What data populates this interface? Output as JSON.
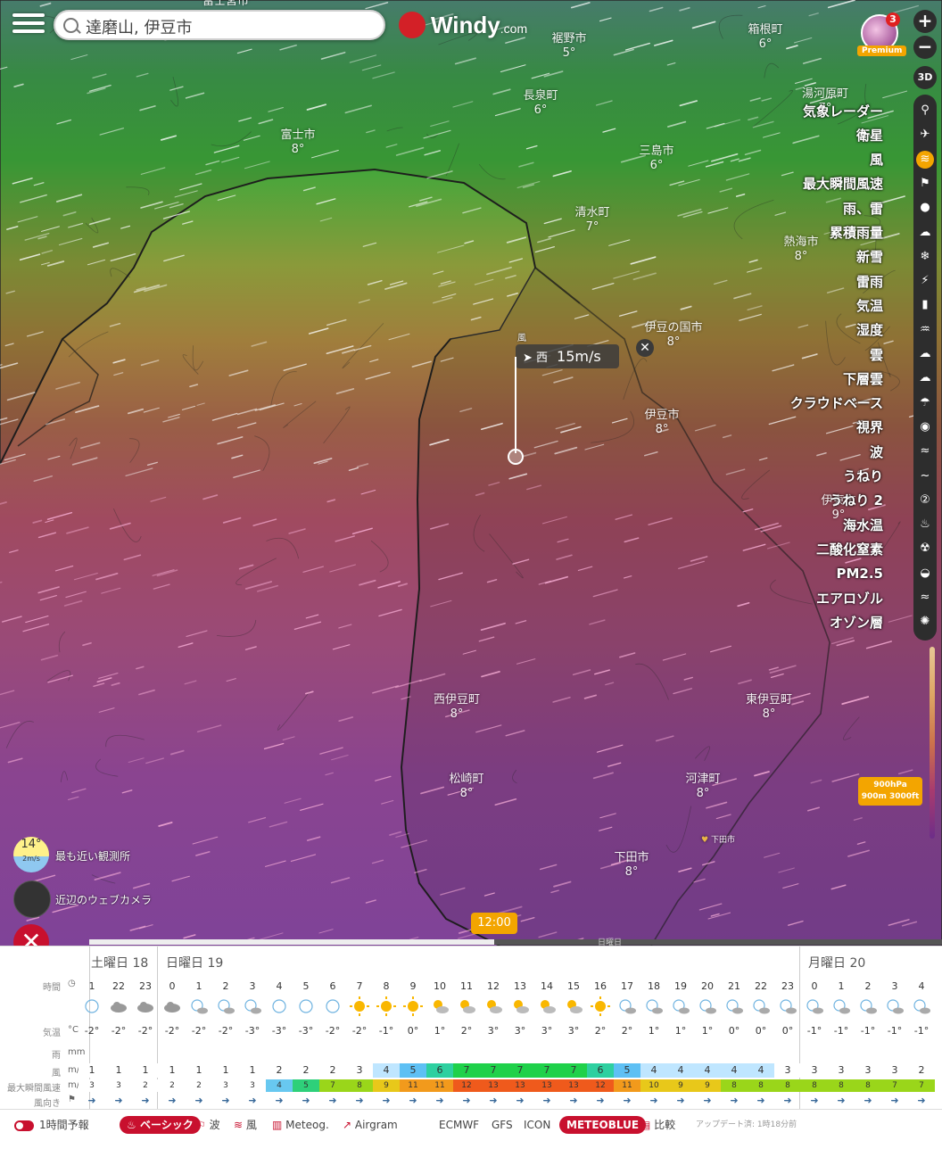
{
  "search": {
    "value": "達磨山, 伊豆市"
  },
  "logo": {
    "brand": "Windy",
    "suffix": ".com"
  },
  "user": {
    "badge": "3",
    "premium": "Premium"
  },
  "controls": {
    "zoom_in": "+",
    "zoom_out": "−",
    "view3d": "3D"
  },
  "layers": [
    {
      "label": "気象レーダー",
      "icon": "radar-icon",
      "glyph": "⚲",
      "active": false
    },
    {
      "label": "衛星",
      "icon": "satellite-icon",
      "glyph": "✈",
      "active": false
    },
    {
      "label": "風",
      "icon": "wind-icon",
      "glyph": "≋",
      "active": true
    },
    {
      "label": "最大瞬間風速",
      "icon": "flag-icon",
      "glyph": "⚑",
      "active": false
    },
    {
      "label": "雨、雷",
      "icon": "raindrop-icon",
      "glyph": "●",
      "active": false
    },
    {
      "label": "累積雨量",
      "icon": "cloud-rain-icon",
      "glyph": "☁",
      "active": false
    },
    {
      "label": "新雪",
      "icon": "snowflake-icon",
      "glyph": "❄",
      "active": false
    },
    {
      "label": "雷雨",
      "icon": "thunder-icon",
      "glyph": "⚡",
      "active": false
    },
    {
      "label": "気温",
      "icon": "thermometer-icon",
      "glyph": "▮",
      "active": false
    },
    {
      "label": "湿度",
      "icon": "humidity-icon",
      "glyph": "♒",
      "active": false
    },
    {
      "label": "雲",
      "icon": "cloud-icon",
      "glyph": "☁",
      "active": false
    },
    {
      "label": "下層雲",
      "icon": "low-cloud-icon",
      "glyph": "☁",
      "active": false
    },
    {
      "label": "クラウドベース",
      "icon": "cloud-base-icon",
      "glyph": "☂",
      "active": false
    },
    {
      "label": "視界",
      "icon": "eye-icon",
      "glyph": "◉",
      "active": false
    },
    {
      "label": "波",
      "icon": "waves-icon",
      "glyph": "≈",
      "active": false
    },
    {
      "label": "うねり",
      "icon": "swimmer-icon",
      "glyph": "~",
      "active": false
    },
    {
      "label": "うねり 2",
      "icon": "swell2-icon",
      "glyph": "②",
      "active": false
    },
    {
      "label": "海水温",
      "icon": "sea-temp-icon",
      "glyph": "♨",
      "active": false
    },
    {
      "label": "二酸化窒素",
      "icon": "no2-icon",
      "glyph": "☢",
      "active": false
    },
    {
      "label": "PM2.5",
      "icon": "pm25-icon",
      "glyph": "◒",
      "active": false
    },
    {
      "label": "エアロゾル",
      "icon": "aerosol-icon",
      "glyph": "≈",
      "active": false
    },
    {
      "label": "オゾン層",
      "icon": "ozone-icon",
      "glyph": "✺",
      "active": false
    }
  ],
  "cities": [
    {
      "name": "富士宮市",
      "temp": ""
    },
    {
      "name": "裾野市",
      "temp": "5°"
    },
    {
      "name": "箱根町",
      "temp": "6°"
    },
    {
      "name": "長泉町",
      "temp": "6°"
    },
    {
      "name": "湯河原町",
      "temp": "7°"
    },
    {
      "name": "富士市",
      "temp": "8°"
    },
    {
      "name": "三島市",
      "temp": "6°"
    },
    {
      "name": "清水町",
      "temp": "7°"
    },
    {
      "name": "熱海市",
      "temp": "8°"
    },
    {
      "name": "伊豆の国市",
      "temp": "8°"
    },
    {
      "name": "伊豆市",
      "temp": "8°"
    },
    {
      "name": "伊東市",
      "temp": "9°"
    },
    {
      "name": "西伊豆町",
      "temp": "8°"
    },
    {
      "name": "東伊豆町",
      "temp": "8°"
    },
    {
      "name": "松崎町",
      "temp": "8°"
    },
    {
      "name": "河津町",
      "temp": "8°"
    },
    {
      "name": "下田市",
      "temp": "8°"
    }
  ],
  "favorite": {
    "label": "下田市"
  },
  "popup": {
    "layer": "風",
    "direction": "西",
    "speed": "15m/s"
  },
  "pressure": {
    "level": "900hPa",
    "alt": "900m 3000ft"
  },
  "left_panel": {
    "station_temp": "14°",
    "station_wind": "2m/s",
    "station_label": "最も近い観測所",
    "webcam_label": "近辺のウェブカメラ",
    "close": "✕"
  },
  "timeline": {
    "current": "12:00",
    "progress": 0.475,
    "next_label": "日曜日"
  },
  "forecast": {
    "days": [
      {
        "label": "土曜日 18"
      },
      {
        "label": "日曜日 19"
      },
      {
        "label": "月曜日 20"
      }
    ],
    "row_labels": {
      "time": "時間",
      "temp": "気温",
      "rain": "雨",
      "wind": "風",
      "gust": "最大瞬間風速",
      "dir": "風向き"
    },
    "units": {
      "temp": "°C",
      "rain": "mm",
      "wind": "m/s",
      "gust": "m/s"
    },
    "hours": [
      "1",
      "22",
      "23",
      "0",
      "1",
      "2",
      "3",
      "4",
      "5",
      "6",
      "7",
      "8",
      "9",
      "10",
      "11",
      "12",
      "13",
      "14",
      "15",
      "16",
      "17",
      "18",
      "19",
      "20",
      "21",
      "22",
      "23",
      "0",
      "1",
      "2",
      "3",
      "4"
    ],
    "weather": [
      "moon",
      "cloud",
      "cloud",
      "cloud",
      "moon-cloud",
      "moon-cloud",
      "moon-cloud",
      "moon",
      "moon",
      "moon",
      "sun",
      "sun",
      "sun",
      "sun-cloud",
      "sun-cloud",
      "sun-cloud",
      "sun-cloud",
      "sun-cloud",
      "sun-cloud",
      "sun",
      "moon-cloud",
      "moon-cloud",
      "moon-cloud",
      "moon-cloud",
      "moon-cloud",
      "moon-cloud",
      "moon-cloud",
      "moon-cloud",
      "moon-cloud",
      "moon-cloud",
      "moon-cloud",
      "moon-cloud"
    ],
    "temps": [
      "-2°",
      "-2°",
      "-2°",
      "-2°",
      "-2°",
      "-2°",
      "-3°",
      "-3°",
      "-3°",
      "-2°",
      "-2°",
      "-1°",
      "0°",
      "1°",
      "2°",
      "3°",
      "3°",
      "3°",
      "3°",
      "2°",
      "2°",
      "1°",
      "1°",
      "1°",
      "0°",
      "0°",
      "0°",
      "-1°",
      "-1°",
      "-1°",
      "-1°",
      "-1°"
    ],
    "wind": [
      "1",
      "1",
      "1",
      "1",
      "1",
      "1",
      "1",
      "2",
      "2",
      "2",
      "3",
      "4",
      "5",
      "6",
      "7",
      "7",
      "7",
      "7",
      "7",
      "6",
      "5",
      "4",
      "4",
      "4",
      "4",
      "4",
      "3",
      "3",
      "3",
      "3",
      "3",
      "2"
    ],
    "gust": [
      "3",
      "3",
      "2",
      "2",
      "2",
      "3",
      "3",
      "4",
      "5",
      "7",
      "8",
      "9",
      "11",
      "11",
      "12",
      "13",
      "13",
      "13",
      "13",
      "12",
      "11",
      "10",
      "9",
      "9",
      "8",
      "8",
      "8",
      "8",
      "8",
      "8",
      "7",
      "7"
    ]
  },
  "bottom": {
    "hourly": "1時間予報",
    "basic": "ベーシック",
    "waves": "波",
    "wind": "風",
    "meteogram": "Meteog.",
    "airgram": "Airgram",
    "ecmwf": "ECMWF",
    "gfs": "GFS",
    "icon": "ICON",
    "meteoblue": "METEOBLUE",
    "compare": "比較",
    "updated": "アップデート済: 1時18分前"
  },
  "colors": {
    "accent": "#c8102e",
    "orange": "#f3a500",
    "panel_dark": "#2d2d2d"
  }
}
